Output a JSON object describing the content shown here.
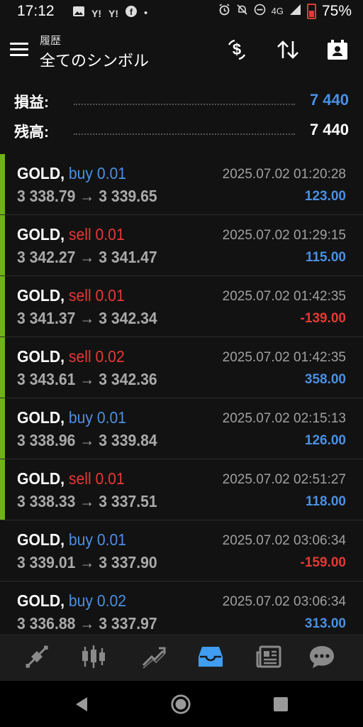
{
  "status_bar": {
    "time": "17:12",
    "icons_left": [
      "image-icon",
      "yahoo-icon",
      "yahoo-icon",
      "facebook-icon",
      "dot-icon"
    ],
    "icons_right": [
      "alarm-icon",
      "mute-icon",
      "dnd-icon",
      "4g-icon",
      "signal-icon"
    ],
    "network": "4G",
    "battery": "75%"
  },
  "header": {
    "subtitle": "履歴",
    "title": "全てのシンボル"
  },
  "summary": {
    "profit_label": "損益:",
    "profit_value": "7 440",
    "balance_label": "残高:",
    "balance_value": "7 440"
  },
  "deals": [
    {
      "symbol": "GOLD,",
      "side": "buy 0.01",
      "side_type": "buy",
      "prices": "3 338.79 → 3 339.65",
      "time": "2025.07.02 01:20:28",
      "profit": "123.00",
      "marked": true
    },
    {
      "symbol": "GOLD,",
      "side": "sell 0.01",
      "side_type": "sell",
      "prices": "3 342.27 → 3 341.47",
      "time": "2025.07.02 01:29:15",
      "profit": "115.00",
      "marked": true
    },
    {
      "symbol": "GOLD,",
      "side": "sell 0.01",
      "side_type": "sell",
      "prices": "3 341.37 → 3 342.34",
      "time": "2025.07.02 01:42:35",
      "profit": "-139.00",
      "marked": true
    },
    {
      "symbol": "GOLD,",
      "side": "sell 0.02",
      "side_type": "sell",
      "prices": "3 343.61 → 3 342.36",
      "time": "2025.07.02 01:42:35",
      "profit": "358.00",
      "marked": true
    },
    {
      "symbol": "GOLD,",
      "side": "buy 0.01",
      "side_type": "buy",
      "prices": "3 338.96 → 3 339.84",
      "time": "2025.07.02 02:15:13",
      "profit": "126.00",
      "marked": true
    },
    {
      "symbol": "GOLD,",
      "side": "sell 0.01",
      "side_type": "sell",
      "prices": "3 338.33 → 3 337.51",
      "time": "2025.07.02 02:51:27",
      "profit": "118.00",
      "marked": true
    },
    {
      "symbol": "GOLD,",
      "side": "buy 0.01",
      "side_type": "buy",
      "prices": "3 339.01 → 3 337.90",
      "time": "2025.07.02 03:06:34",
      "profit": "-159.00",
      "marked": false
    },
    {
      "symbol": "GOLD,",
      "side": "buy 0.02",
      "side_type": "buy",
      "prices": "3 336.88 → 3 337.97",
      "time": "2025.07.02 03:06:34",
      "profit": "313.00",
      "marked": false
    }
  ],
  "bottom_tabs": [
    {
      "icon": "quotes-icon",
      "active": false
    },
    {
      "icon": "chart-icon",
      "active": false
    },
    {
      "icon": "trade-icon",
      "active": false
    },
    {
      "icon": "history-icon",
      "active": true
    },
    {
      "icon": "news-icon",
      "active": false
    },
    {
      "icon": "messages-icon",
      "active": false
    }
  ],
  "colors": {
    "background": "#121212",
    "buy": "#4a90e2",
    "sell": "#e53935",
    "positive": "#4a90e2",
    "negative": "#e53935",
    "marker": "#6fb318",
    "active_tab": "#3f9df2",
    "inactive_tab": "#8a8a8a"
  }
}
